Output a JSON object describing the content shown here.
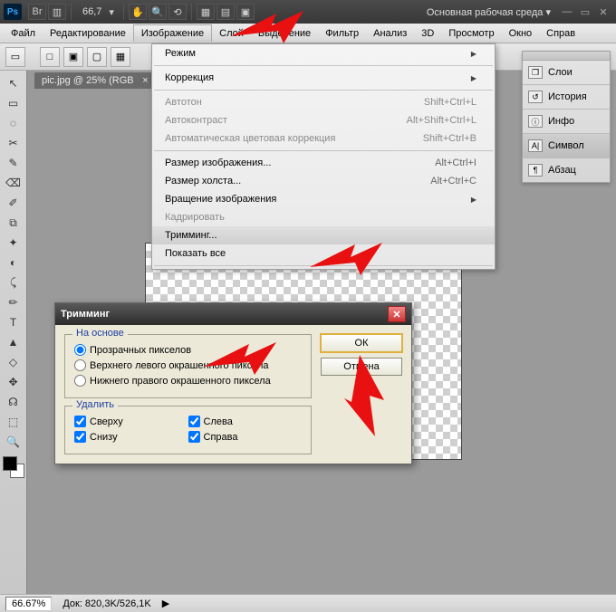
{
  "titlebar": {
    "zoom": "66,7",
    "workspace": "Основная рабочая среда ▾"
  },
  "menubar": [
    "Файл",
    "Редактирование",
    "Изображение",
    "Слой",
    "Выделение",
    "Фильтр",
    "Анализ",
    "3D",
    "Просмотр",
    "Окно",
    "Справ"
  ],
  "menubar_active_index": 2,
  "doc_tab": "pic.jpg @ 25% (RGB",
  "dropdown": [
    {
      "type": "arrow",
      "label": "Режим"
    },
    {
      "type": "sep"
    },
    {
      "type": "arrow",
      "label": "Коррекция"
    },
    {
      "type": "sep"
    },
    {
      "type": "disabled",
      "label": "Автотон",
      "shortcut": "Shift+Ctrl+L"
    },
    {
      "type": "disabled",
      "label": "Автоконтраст",
      "shortcut": "Alt+Shift+Ctrl+L"
    },
    {
      "type": "disabled",
      "label": "Автоматическая цветовая коррекция",
      "shortcut": "Shift+Ctrl+B"
    },
    {
      "type": "sep"
    },
    {
      "type": "item",
      "label": "Размер изображения...",
      "shortcut": "Alt+Ctrl+I"
    },
    {
      "type": "item",
      "label": "Размер холста...",
      "shortcut": "Alt+Ctrl+C"
    },
    {
      "type": "arrow",
      "label": "Вращение изображения"
    },
    {
      "type": "disabled",
      "label": "Кадрировать"
    },
    {
      "type": "highlight",
      "label": "Тримминг..."
    },
    {
      "type": "item",
      "label": "Показать все"
    },
    {
      "type": "sep"
    }
  ],
  "side_panel": [
    {
      "icon": "❐",
      "label": "Слои"
    },
    {
      "icon": "↺",
      "label": "История"
    },
    {
      "icon": "ⓘ",
      "label": "Инфо"
    },
    {
      "icon": "A|",
      "label": "Символ",
      "active": true
    },
    {
      "icon": "¶",
      "label": "Абзац"
    }
  ],
  "dialog": {
    "title": "Тримминг",
    "group1_legend": "На основе",
    "radios": [
      {
        "label": "Прозрачных пикселов",
        "checked": true
      },
      {
        "label": "Верхнего левого окрашенного пиксела",
        "checked": false
      },
      {
        "label": "Нижнего правого окрашенного пиксела",
        "checked": false
      }
    ],
    "group2_legend": "Удалить",
    "checks": [
      {
        "label": "Сверху",
        "checked": true
      },
      {
        "label": "Слева",
        "checked": true
      },
      {
        "label": "Снизу",
        "checked": true
      },
      {
        "label": "Справа",
        "checked": true
      }
    ],
    "ok": "ОК",
    "cancel": "Отмена"
  },
  "tools": [
    "↖",
    "▭",
    "◌",
    "✂",
    "✎",
    "⌫",
    "✐",
    "⧉",
    "✦",
    "◐",
    "⤹",
    "✏",
    "T",
    "▲",
    "◇",
    "✥",
    "☊",
    "⬚",
    "🔍"
  ],
  "status": {
    "zoom": "66.67%",
    "doc": "Док: 820,3K/526,1K"
  }
}
